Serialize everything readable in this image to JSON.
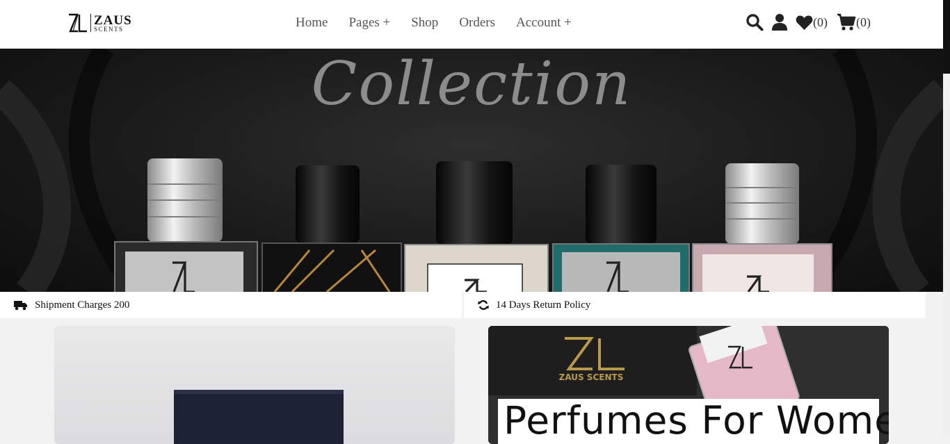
{
  "brand": {
    "line1": "ZAUS",
    "line2": "SCENTS"
  },
  "nav": [
    {
      "label": "Home"
    },
    {
      "label": "Pages +"
    },
    {
      "label": "Shop"
    },
    {
      "label": "Orders"
    },
    {
      "label": "Account +"
    }
  ],
  "tools": {
    "search_icon": "search-icon",
    "user_icon": "user-icon",
    "wishlist_count": "(0)",
    "cart_count": "(0)"
  },
  "hero": {
    "script_text": "Collection"
  },
  "info": {
    "shipment": "Shipment Charges 200",
    "returns": "14 Days Return Policy"
  },
  "cards": {
    "women_text": "Perfumes For Women",
    "box_brand_line1": "ZAUS SCENTS"
  },
  "colors": {
    "accent": "#111111",
    "gold": "#b89a4a"
  }
}
